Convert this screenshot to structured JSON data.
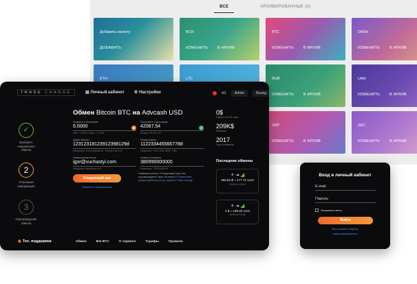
{
  "tabs": {
    "all": "ВСЕ",
    "archived": "АРХИВИРОВАННЫЕ (0)"
  },
  "wallets": [
    {
      "name": "Добавить валюту",
      "actions": [
        "ДОБАВИТЬ"
      ],
      "gradient": "linear-gradient(135deg,#1f6f9a,#2a8f9a 45%,#e8e0a8)"
    },
    {
      "name": "BCH",
      "actions": [
        "ИЗМЕНИТЬ",
        "В АРХИВ"
      ],
      "gradient": "linear-gradient(135deg,#2a8f6e,#3aa58a 50%,#b8d06a)"
    },
    {
      "name": "BTC",
      "actions": [
        "ИЗМЕНИТЬ",
        "В АРХИВ"
      ],
      "gradient": "linear-gradient(135deg,#e04a7a,#9a5ab0 50%,#3ab0c0)"
    },
    {
      "name": "DASH",
      "actions": [
        "ИЗМЕНИТЬ",
        "В АРХИВ"
      ],
      "gradient": "linear-gradient(135deg,#7a5ac8,#c06a9a 55%,#e0a080)"
    },
    {
      "name": "ETH",
      "actions": [],
      "gradient": "linear-gradient(135deg,#3a7ac0,#4aa0c8)"
    },
    {
      "name": "LTC",
      "actions": [],
      "gradient": "linear-gradient(135deg,#3a9ad0,#58b8e0)"
    },
    {
      "name": "RUB",
      "actions": [
        "ИЗМЕНИТЬ",
        "В АРХИВ"
      ],
      "gradient": "linear-gradient(135deg,#2a8a6a,#3aa07a 55%,#8ab86a)"
    },
    {
      "name": "UAH",
      "actions": [
        "ИЗМЕНИТЬ",
        "В АРХИВ"
      ],
      "gradient": "linear-gradient(135deg,#4a3a9a,#6a4ab0 55%,#9a6ac8)"
    },
    {
      "name": "XRP",
      "actions": [
        "ИЗМЕНИТЬ",
        "В АРХИВ"
      ],
      "gradient": "linear-gradient(135deg,#d04a7a,#b05ab0 55%,#6a7ad0)"
    },
    {
      "name": "ZEC",
      "actions": [
        "ИЗМЕНИТЬ",
        "В АРХИВ"
      ],
      "gradient": "linear-gradient(135deg,#8a5ac8,#b07ad0 55%,#e0a8c8)"
    }
  ],
  "header": {
    "logo_a": "TRADE",
    "logo_b": "CHANGE",
    "nav_cabinet": "Личный кабинет",
    "nav_settings": "Настройки",
    "user_id": "Id1",
    "admin": "Admin",
    "logout": "Выход"
  },
  "steps": [
    {
      "num": "✓",
      "label": "Выберите направление обмена"
    },
    {
      "num": "2",
      "label": "Платежная информация"
    },
    {
      "num": "3",
      "label": "Подтверждение обмена"
    }
  ],
  "form": {
    "title_a": "Обмен",
    "title_b": "Bitcoin BTC",
    "title_c": "на",
    "title_d": "Advcash USD",
    "give_label": "Отдаете в биткоинах",
    "give_value": "5.0000",
    "give_hint": "Мин.: 0.0491 | Макс.: 9.0916",
    "get_label": "Получаете в долларах",
    "get_value": "42087.54",
    "get_hint": "Резерв: 99 920.US",
    "addr_label": "Адрес Bitcoin",
    "addr_value": "12312318123912398129d",
    "addr_hint": "Например: 1wmTkgSrkA2N...ZheszHLNKC47",
    "card_label": "Номер карты",
    "card_value": "1122334455667788",
    "card_hint": "Например: 7400 2849 6552 7788",
    "email_label": "Электронная почта",
    "email_value": "igor@vuchastyi.com",
    "email_hint": "Например: test@test.com",
    "phone_label": "Номер телефона",
    "phone_value": "380990000000",
    "phone_hint": "Например: 79312345678",
    "next_btn": "Следующий шаг",
    "change_dir": "Изменить направление",
    "notice_a": "Нажимая кнопку «Следующий шаг» вы подтверждаете свое согласие с",
    "notice_link": "Правилами предоставления услуг сервиса Trade-change"
  },
  "stats": [
    {
      "big": "0$",
      "sm": "Оборот за 24 часа"
    },
    {
      "big": "209K$",
      "sm": "Резервы"
    },
    {
      "big": "2017",
      "sm": "Год основания"
    }
  ],
  "last_title": "Последние обмены",
  "exchanges": [
    {
      "amount": "404.64 ₽ = 177.71 UAH",
      "time": "10:00:11 10.04"
    },
    {
      "amount": "4 $ = 109.43 UAH",
      "time": "10:00:11 10.04"
    }
  ],
  "footer": {
    "support": "Тех. поддержка",
    "links": [
      "Обмен",
      "Bet BTC",
      "О сервисе",
      "Тарифы",
      "Правила"
    ]
  },
  "login": {
    "title": "Вход в личный кабинет",
    "email": "E-mail",
    "password": "Пароль",
    "remember": "Запомнить меня",
    "button": "Войти",
    "restore": "Восстановить пароль",
    "register": "Зарегистрироваться"
  },
  "colors": {
    "accent": "#f08a2a",
    "success": "#67bf3c",
    "link": "#5a8ee8",
    "dark": "#0b0b0d"
  }
}
